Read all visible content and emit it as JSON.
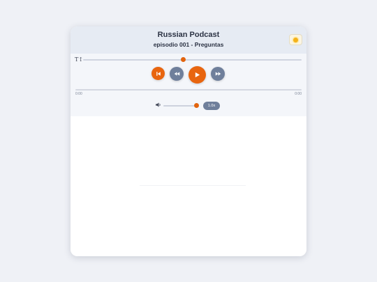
{
  "header": {
    "podcast_title": "Russian Podcast",
    "episode_title": "episodio 001 - Preguntas",
    "theme_icon": "sun-icon"
  },
  "player": {
    "font_size_icon_label": "T↕",
    "font_size_level": 0.45,
    "controls": {
      "previous_icon": "skip-previous-icon",
      "rewind_icon": "rewind-icon",
      "play_icon": "play-icon",
      "forward_icon": "fast-forward-icon"
    },
    "progress": {
      "current_time": "0:00",
      "total_time": "0:00",
      "value": 0
    },
    "volume": {
      "icon": "volume-icon",
      "level": 1.0
    },
    "speed_label": "1.0x"
  },
  "colors": {
    "accent": "#e8650f",
    "secondary": "#6f7f9b",
    "header_bg": "#e6ebf3",
    "page_bg": "#eff1f6"
  }
}
